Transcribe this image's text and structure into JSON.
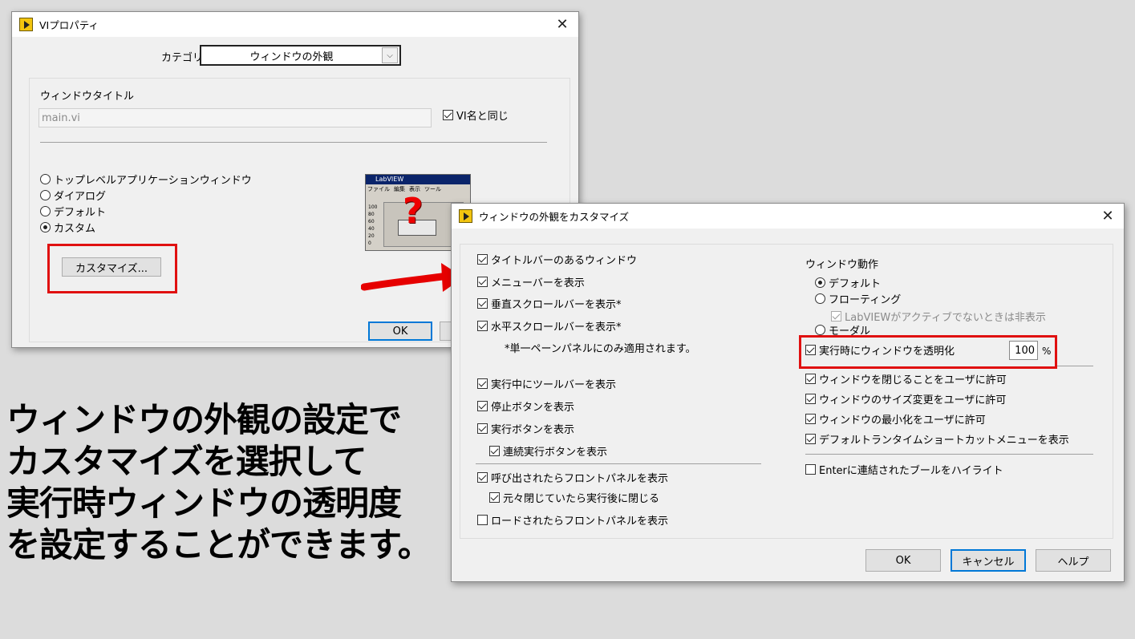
{
  "vi_properties": {
    "title": "VIプロパティ",
    "category_label": "カテゴリ",
    "category_value": "ウィンドウの外観",
    "window_title_label": "ウィンドウタイトル",
    "window_title_value": "main.vi",
    "same_as_vi_name": "VI名と同じ",
    "radio_options": [
      "トップレベルアプリケーションウィンドウ",
      "ダイアログ",
      "デフォルト",
      "カスタム"
    ],
    "selected_option": "カスタム",
    "customize_button": "カスタマイズ...",
    "ok_button": "OK",
    "preview": {
      "title": "LabVIEW",
      "menu": [
        "ファイル",
        "編集",
        "表示",
        "ツール"
      ],
      "scale": [
        "100",
        "80",
        "60",
        "40",
        "20",
        "0"
      ],
      "question_mark": "?"
    }
  },
  "customize_dialog": {
    "title": "ウィンドウの外観をカスタマイズ",
    "left_options": [
      {
        "label": "タイトルバーのあるウィンドウ",
        "checked": true
      },
      {
        "label": "メニューバーを表示",
        "checked": true
      },
      {
        "label": "垂直スクロールバーを表示*",
        "checked": true
      },
      {
        "label": "水平スクロールバーを表示*",
        "checked": true
      }
    ],
    "footnote": "*単一ペーンパネルにのみ適用されます。",
    "toolbar_options": [
      {
        "label": "実行中にツールバーを表示",
        "checked": true
      },
      {
        "label": "停止ボタンを表示",
        "checked": true
      },
      {
        "label": "実行ボタンを表示",
        "checked": true
      },
      {
        "label": "連続実行ボタンを表示",
        "checked": true
      }
    ],
    "panel_options": [
      {
        "label": "呼び出されたらフロントパネルを表示",
        "checked": true
      },
      {
        "label": "元々閉じていたら実行後に閉じる",
        "checked": true
      },
      {
        "label": "ロードされたらフロントパネルを表示",
        "checked": false
      }
    ],
    "window_behavior_label": "ウィンドウ動作",
    "behavior_options": [
      "デフォルト",
      "フローティング",
      "モーダル"
    ],
    "selected_behavior": "デフォルト",
    "hide_when_inactive": "LabVIEWがアクティブでないときは非表示",
    "transparency_label": "実行時にウィンドウを透明化",
    "transparency_value": "100",
    "transparency_unit": "%",
    "right_options": [
      {
        "label": "ウィンドウを閉じることをユーザに許可",
        "checked": true
      },
      {
        "label": "ウィンドウのサイズ変更をユーザに許可",
        "checked": true
      },
      {
        "label": "ウィンドウの最小化をユーザに許可",
        "checked": true
      },
      {
        "label": "デフォルトランタイムショートカットメニューを表示",
        "checked": true
      }
    ],
    "highlight_enter": "Enterに連結されたブールをハイライト",
    "ok_button": "OK",
    "cancel_button": "キャンセル",
    "help_button": "ヘルプ"
  },
  "caption": [
    "ウィンドウの外観の設定で",
    "カスタマイズを選択して",
    "実行時ウィンドウの透明度",
    "を設定することができます。"
  ],
  "colors": {
    "highlight_box": "#e01010",
    "arrow": "#e60000",
    "default_button_border": "#0078d7"
  }
}
